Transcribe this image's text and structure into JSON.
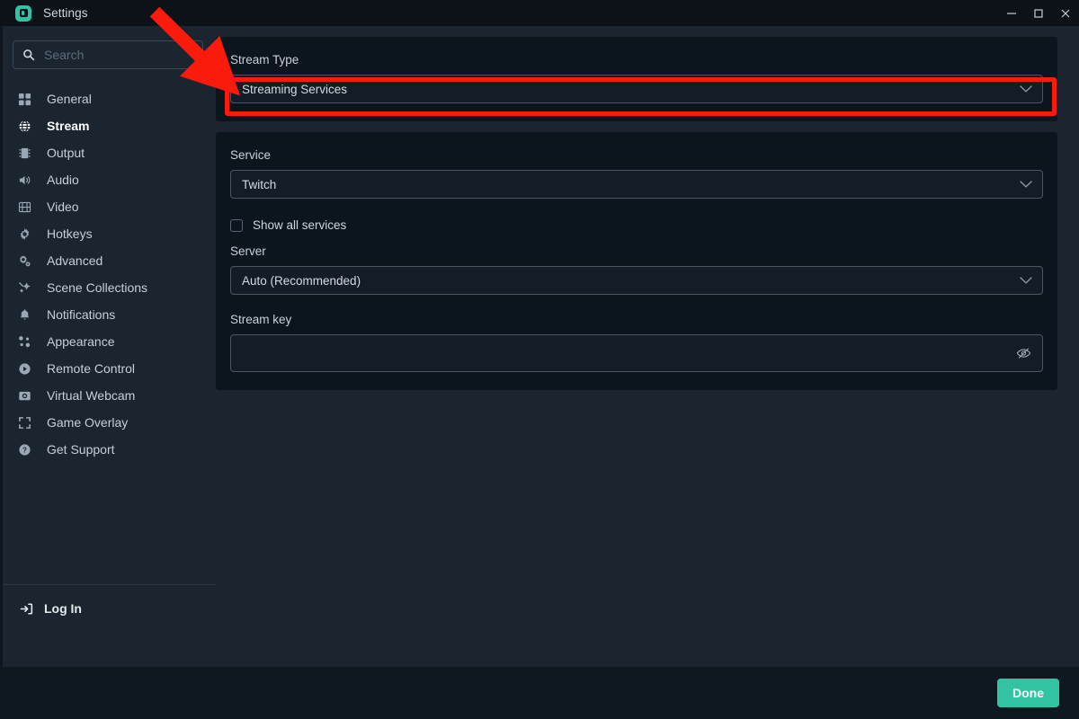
{
  "window": {
    "title": "Settings",
    "logo_icon": "streamlabs-logo-icon",
    "controls": [
      {
        "name": "minimize-button",
        "icon": "minimize-icon"
      },
      {
        "name": "maximize-button",
        "icon": "maximize-icon"
      },
      {
        "name": "close-button",
        "icon": "close-icon"
      }
    ]
  },
  "sidebar": {
    "search": {
      "placeholder": "Search",
      "icon": "search-icon",
      "value": ""
    },
    "items": [
      {
        "label": "General",
        "icon": "grid-icon",
        "active": false
      },
      {
        "label": "Stream",
        "icon": "globe-icon",
        "active": true
      },
      {
        "label": "Output",
        "icon": "chip-icon",
        "active": false
      },
      {
        "label": "Audio",
        "icon": "speaker-icon",
        "active": false
      },
      {
        "label": "Video",
        "icon": "film-icon",
        "active": false
      },
      {
        "label": "Hotkeys",
        "icon": "gear-icon",
        "active": false
      },
      {
        "label": "Advanced",
        "icon": "gears-icon",
        "active": false
      },
      {
        "label": "Scene Collections",
        "icon": "sparkle-icon",
        "active": false
      },
      {
        "label": "Notifications",
        "icon": "bell-icon",
        "active": false
      },
      {
        "label": "Appearance",
        "icon": "dots-icon",
        "active": false
      },
      {
        "label": "Remote Control",
        "icon": "play-circle-icon",
        "active": false
      },
      {
        "label": "Virtual Webcam",
        "icon": "camera-icon",
        "active": false
      },
      {
        "label": "Game Overlay",
        "icon": "expand-icon",
        "active": false
      },
      {
        "label": "Get Support",
        "icon": "question-circle-icon",
        "active": false
      }
    ],
    "login": {
      "label": "Log In",
      "icon": "login-icon"
    }
  },
  "main": {
    "stream_type": {
      "label": "Stream Type",
      "value": "Streaming Services",
      "chevron_icon": "chevron-down-icon"
    },
    "service": {
      "label": "Service",
      "value": "Twitch",
      "chevron_icon": "chevron-down-icon"
    },
    "show_all_services": {
      "label": "Show all services",
      "checked": false
    },
    "server": {
      "label": "Server",
      "value": "Auto (Recommended)",
      "chevron_icon": "chevron-down-icon"
    },
    "stream_key": {
      "label": "Stream key",
      "value": "",
      "reveal_icon": "eye-slash-icon"
    }
  },
  "footer": {
    "done_label": "Done"
  },
  "annotation": {
    "highlight_color": "#fa1b0c",
    "arrow_color": "#fa1b0c",
    "target": "Stream Type dropdown"
  }
}
